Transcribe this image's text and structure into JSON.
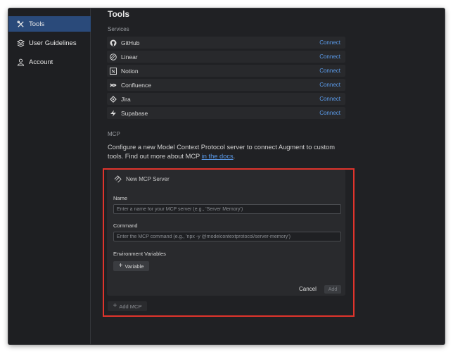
{
  "sidebar": {
    "items": [
      {
        "label": "Tools",
        "icon": "tools-icon",
        "active": true
      },
      {
        "label": "User Guidelines",
        "icon": "layers-icon",
        "active": false
      },
      {
        "label": "Account",
        "icon": "person-icon",
        "active": false
      }
    ]
  },
  "main": {
    "title": "Tools",
    "services_label": "Services",
    "services": [
      {
        "name": "GitHub",
        "icon": "github-icon",
        "action": "Connect"
      },
      {
        "name": "Linear",
        "icon": "linear-icon",
        "action": "Connect"
      },
      {
        "name": "Notion",
        "icon": "notion-icon",
        "action": "Connect"
      },
      {
        "name": "Confluence",
        "icon": "confluence-icon",
        "action": "Connect"
      },
      {
        "name": "Jira",
        "icon": "jira-icon",
        "action": "Connect"
      },
      {
        "name": "Supabase",
        "icon": "supabase-icon",
        "action": "Connect"
      }
    ],
    "mcp_label": "MCP",
    "mcp_description": "Configure a new Model Context Protocol server to connect Augment to custom tools. Find out more about MCP ",
    "mcp_docs_link": "in the docs",
    "mcp_description_end": "."
  },
  "new_server": {
    "heading": "New MCP Server",
    "name_label": "Name",
    "name_placeholder": "Enter a name for your MCP server (e.g., 'Server Memory')",
    "command_label": "Command",
    "command_placeholder": "Enter the MCP command (e.g., 'npx -y @modelcontextprotocol/server-memory')",
    "env_label": "Environment Variables",
    "variable_button": "Variable",
    "cancel": "Cancel",
    "add": "Add"
  },
  "add_mcp_button": "Add MCP",
  "colors": {
    "background": "#202124",
    "sidebar_active": "#2a4a7a",
    "link": "#5b9bea",
    "highlight_outline": "#e0342c"
  }
}
